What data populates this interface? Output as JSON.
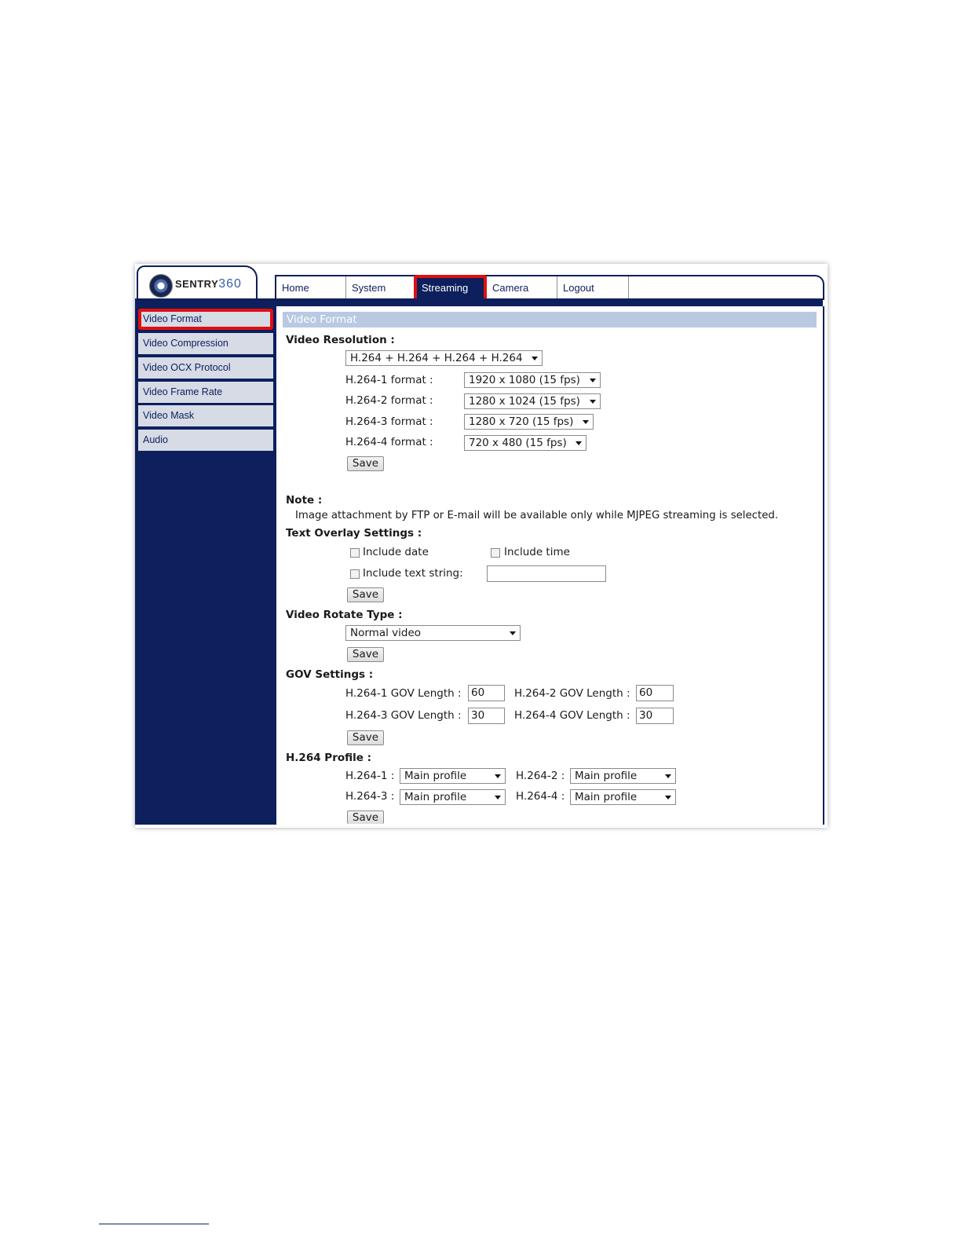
{
  "logo": {
    "brand": "SENTRY",
    "brand_num": "360"
  },
  "nav": {
    "tabs": [
      {
        "label": "Home"
      },
      {
        "label": "System"
      },
      {
        "label": "Streaming"
      },
      {
        "label": "Camera"
      },
      {
        "label": "Logout"
      }
    ],
    "active": "Streaming"
  },
  "sidebar": {
    "items": [
      {
        "label": "Video Format"
      },
      {
        "label": "Video Compression"
      },
      {
        "label": "Video OCX Protocol"
      },
      {
        "label": "Video Frame Rate"
      },
      {
        "label": "Video Mask"
      },
      {
        "label": "Audio"
      }
    ],
    "active": "Video Format"
  },
  "main": {
    "section_title": "Video Format",
    "video_resolution": {
      "heading": "Video Resolution :",
      "mode_value": "H.264 + H.264 + H.264 + H.264",
      "rows": [
        {
          "label": "H.264-1 format :",
          "value": "1920 x 1080 (15 fps)"
        },
        {
          "label": "H.264-2 format :",
          "value": "1280 x 1024 (15 fps)"
        },
        {
          "label": "H.264-3 format :",
          "value": "1280 x 720 (15 fps)"
        },
        {
          "label": "H.264-4 format :",
          "value": "720 x 480 (15 fps)"
        }
      ],
      "save_label": "Save"
    },
    "note": {
      "heading": "Note :",
      "text": "Image attachment by FTP or E-mail will be available only while MJPEG streaming is selected."
    },
    "text_overlay": {
      "heading": "Text Overlay Settings :",
      "include_date": "Include date",
      "include_time": "Include time",
      "include_text": "Include text string:",
      "text_value": "",
      "save_label": "Save"
    },
    "video_rotate": {
      "heading": "Video Rotate Type :",
      "value": "Normal video",
      "save_label": "Save"
    },
    "gov": {
      "heading": "GOV Settings :",
      "items": [
        {
          "label": "H.264-1 GOV Length :",
          "value": "60"
        },
        {
          "label": "H.264-2 GOV Length :",
          "value": "60"
        },
        {
          "label": "H.264-3 GOV Length :",
          "value": "30"
        },
        {
          "label": "H.264-4 GOV Length :",
          "value": "30"
        }
      ],
      "save_label": "Save"
    },
    "profile": {
      "heading": "H.264 Profile :",
      "items": [
        {
          "label": "H.264-1 :",
          "value": "Main profile"
        },
        {
          "label": "H.264-2 :",
          "value": "Main profile"
        },
        {
          "label": "H.264-3 :",
          "value": "Main profile"
        },
        {
          "label": "H.264-4 :",
          "value": "Main profile"
        }
      ],
      "save_label": "Save"
    }
  },
  "colors": {
    "navy": "#0d1f5c",
    "highlight": "#e01010",
    "section_bar": "#b9c9e2",
    "sidebar_item": "#d6dbe6"
  }
}
